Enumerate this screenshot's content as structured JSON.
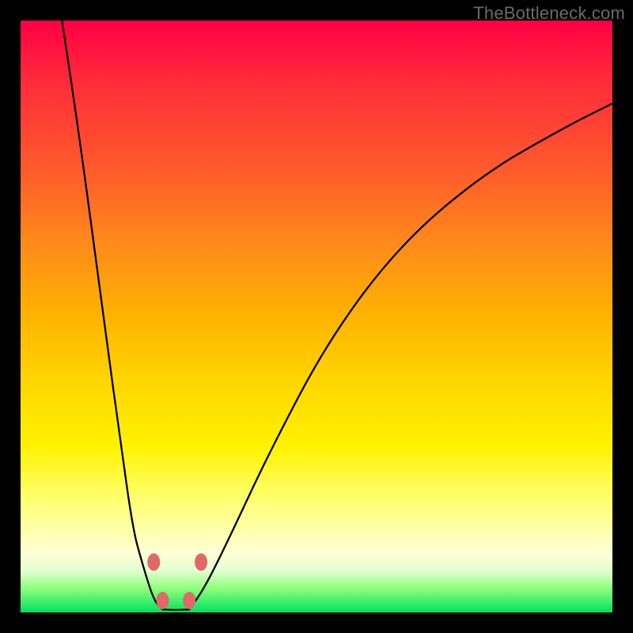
{
  "watermark": "TheBottleneck.com",
  "colors": {
    "bead": "#e06868",
    "curve": "#000000"
  },
  "chart_data": {
    "type": "line",
    "title": "",
    "xlabel": "",
    "ylabel": "",
    "xlim": [
      0,
      100
    ],
    "ylim": [
      0,
      100
    ],
    "grid": false,
    "legend": false,
    "series": [
      {
        "name": "left-branch",
        "x": [
          7,
          10,
          14,
          17,
          19,
          20.5,
          22.5,
          24
        ],
        "y": [
          100,
          80,
          50,
          28,
          14,
          8.5,
          2,
          0.5
        ]
      },
      {
        "name": "flat-bottom",
        "x": [
          24,
          26,
          28.5
        ],
        "y": [
          0.5,
          0.4,
          0.5
        ]
      },
      {
        "name": "right-branch",
        "x": [
          28.5,
          31,
          35,
          42,
          52,
          64,
          78,
          92,
          100
        ],
        "y": [
          0.5,
          4,
          12,
          27,
          46,
          62,
          74,
          82,
          86
        ]
      }
    ],
    "markers": [
      {
        "x": 22.5,
        "y": 8.5
      },
      {
        "x": 24,
        "y": 2
      },
      {
        "x": 28.5,
        "y": 2
      },
      {
        "x": 30.5,
        "y": 8.5
      }
    ]
  }
}
